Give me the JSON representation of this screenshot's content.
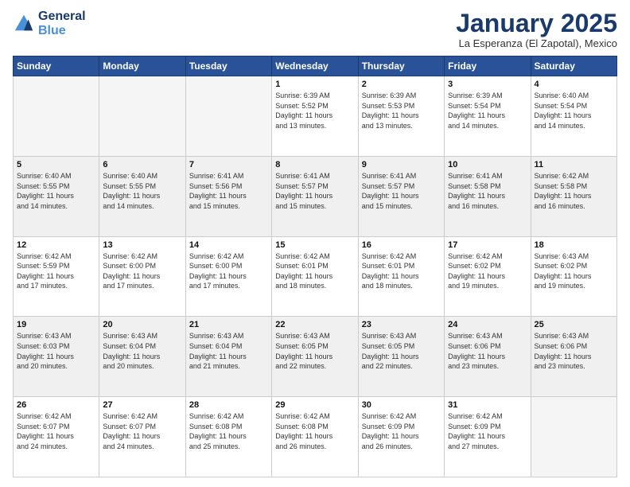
{
  "header": {
    "logo_line1": "General",
    "logo_line2": "Blue",
    "title": "January 2025",
    "subtitle": "La Esperanza (El Zapotal), Mexico"
  },
  "days_of_week": [
    "Sunday",
    "Monday",
    "Tuesday",
    "Wednesday",
    "Thursday",
    "Friday",
    "Saturday"
  ],
  "weeks": [
    [
      {
        "day": "",
        "info": ""
      },
      {
        "day": "",
        "info": ""
      },
      {
        "day": "",
        "info": ""
      },
      {
        "day": "1",
        "info": "Sunrise: 6:39 AM\nSunset: 5:52 PM\nDaylight: 11 hours\nand 13 minutes."
      },
      {
        "day": "2",
        "info": "Sunrise: 6:39 AM\nSunset: 5:53 PM\nDaylight: 11 hours\nand 13 minutes."
      },
      {
        "day": "3",
        "info": "Sunrise: 6:39 AM\nSunset: 5:54 PM\nDaylight: 11 hours\nand 14 minutes."
      },
      {
        "day": "4",
        "info": "Sunrise: 6:40 AM\nSunset: 5:54 PM\nDaylight: 11 hours\nand 14 minutes."
      }
    ],
    [
      {
        "day": "5",
        "info": "Sunrise: 6:40 AM\nSunset: 5:55 PM\nDaylight: 11 hours\nand 14 minutes."
      },
      {
        "day": "6",
        "info": "Sunrise: 6:40 AM\nSunset: 5:55 PM\nDaylight: 11 hours\nand 14 minutes."
      },
      {
        "day": "7",
        "info": "Sunrise: 6:41 AM\nSunset: 5:56 PM\nDaylight: 11 hours\nand 15 minutes."
      },
      {
        "day": "8",
        "info": "Sunrise: 6:41 AM\nSunset: 5:57 PM\nDaylight: 11 hours\nand 15 minutes."
      },
      {
        "day": "9",
        "info": "Sunrise: 6:41 AM\nSunset: 5:57 PM\nDaylight: 11 hours\nand 15 minutes."
      },
      {
        "day": "10",
        "info": "Sunrise: 6:41 AM\nSunset: 5:58 PM\nDaylight: 11 hours\nand 16 minutes."
      },
      {
        "day": "11",
        "info": "Sunrise: 6:42 AM\nSunset: 5:58 PM\nDaylight: 11 hours\nand 16 minutes."
      }
    ],
    [
      {
        "day": "12",
        "info": "Sunrise: 6:42 AM\nSunset: 5:59 PM\nDaylight: 11 hours\nand 17 minutes."
      },
      {
        "day": "13",
        "info": "Sunrise: 6:42 AM\nSunset: 6:00 PM\nDaylight: 11 hours\nand 17 minutes."
      },
      {
        "day": "14",
        "info": "Sunrise: 6:42 AM\nSunset: 6:00 PM\nDaylight: 11 hours\nand 17 minutes."
      },
      {
        "day": "15",
        "info": "Sunrise: 6:42 AM\nSunset: 6:01 PM\nDaylight: 11 hours\nand 18 minutes."
      },
      {
        "day": "16",
        "info": "Sunrise: 6:42 AM\nSunset: 6:01 PM\nDaylight: 11 hours\nand 18 minutes."
      },
      {
        "day": "17",
        "info": "Sunrise: 6:42 AM\nSunset: 6:02 PM\nDaylight: 11 hours\nand 19 minutes."
      },
      {
        "day": "18",
        "info": "Sunrise: 6:43 AM\nSunset: 6:02 PM\nDaylight: 11 hours\nand 19 minutes."
      }
    ],
    [
      {
        "day": "19",
        "info": "Sunrise: 6:43 AM\nSunset: 6:03 PM\nDaylight: 11 hours\nand 20 minutes."
      },
      {
        "day": "20",
        "info": "Sunrise: 6:43 AM\nSunset: 6:04 PM\nDaylight: 11 hours\nand 20 minutes."
      },
      {
        "day": "21",
        "info": "Sunrise: 6:43 AM\nSunset: 6:04 PM\nDaylight: 11 hours\nand 21 minutes."
      },
      {
        "day": "22",
        "info": "Sunrise: 6:43 AM\nSunset: 6:05 PM\nDaylight: 11 hours\nand 22 minutes."
      },
      {
        "day": "23",
        "info": "Sunrise: 6:43 AM\nSunset: 6:05 PM\nDaylight: 11 hours\nand 22 minutes."
      },
      {
        "day": "24",
        "info": "Sunrise: 6:43 AM\nSunset: 6:06 PM\nDaylight: 11 hours\nand 23 minutes."
      },
      {
        "day": "25",
        "info": "Sunrise: 6:43 AM\nSunset: 6:06 PM\nDaylight: 11 hours\nand 23 minutes."
      }
    ],
    [
      {
        "day": "26",
        "info": "Sunrise: 6:42 AM\nSunset: 6:07 PM\nDaylight: 11 hours\nand 24 minutes."
      },
      {
        "day": "27",
        "info": "Sunrise: 6:42 AM\nSunset: 6:07 PM\nDaylight: 11 hours\nand 24 minutes."
      },
      {
        "day": "28",
        "info": "Sunrise: 6:42 AM\nSunset: 6:08 PM\nDaylight: 11 hours\nand 25 minutes."
      },
      {
        "day": "29",
        "info": "Sunrise: 6:42 AM\nSunset: 6:08 PM\nDaylight: 11 hours\nand 26 minutes."
      },
      {
        "day": "30",
        "info": "Sunrise: 6:42 AM\nSunset: 6:09 PM\nDaylight: 11 hours\nand 26 minutes."
      },
      {
        "day": "31",
        "info": "Sunrise: 6:42 AM\nSunset: 6:09 PM\nDaylight: 11 hours\nand 27 minutes."
      },
      {
        "day": "",
        "info": ""
      }
    ]
  ]
}
